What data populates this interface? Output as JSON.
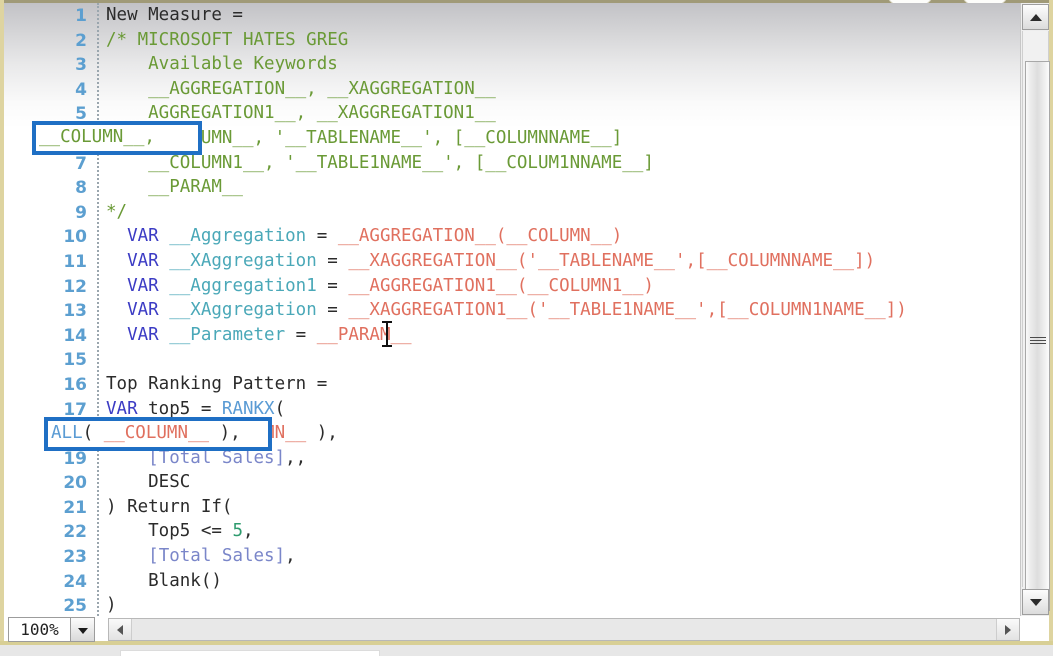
{
  "window": {
    "kind": "dax-formula-editor",
    "accent_box_color": "#1f6fc4",
    "frame_color": "#ded4a0",
    "linenumber_color": "#5c9fd0"
  },
  "gutter": {
    "line_numbers": [
      "1",
      "2",
      "3",
      "4",
      "5",
      "6",
      "7",
      "8",
      "9",
      "10",
      "11",
      "12",
      "13",
      "14",
      "15",
      "16",
      "17",
      "18",
      "19",
      "20",
      "21",
      "22",
      "23",
      "24",
      "25"
    ]
  },
  "code": {
    "lines": [
      {
        "n": "1",
        "tokens": [
          {
            "t": "New Measure =",
            "c": "tok-plain"
          }
        ]
      },
      {
        "n": "2",
        "tokens": [
          {
            "t": "/* MICROSOFT HATES GREG",
            "c": "tok-comment"
          }
        ]
      },
      {
        "n": "3",
        "tokens": [
          {
            "t": "    Available Keywords",
            "c": "tok-comment"
          }
        ]
      },
      {
        "n": "4",
        "tokens": [
          {
            "t": "    __AGGREGATION__, __XAGGREGATION__",
            "c": "tok-comment"
          }
        ]
      },
      {
        "n": "5",
        "tokens": [
          {
            "t": "    AGGREGATION1__, __XAGGREGATION1__",
            "c": "tok-comment"
          }
        ]
      },
      {
        "n": "6",
        "tokens": [
          {
            "t": "    __COLUMN__, '__TABLENAME__', [__COLUMNNAME__]",
            "c": "tok-comment"
          }
        ]
      },
      {
        "n": "7",
        "tokens": [
          {
            "t": "    __COLUMN1__, '__TABLE1NAME__', [__COLUM1NNAME__]",
            "c": "tok-comment"
          }
        ]
      },
      {
        "n": "8",
        "tokens": [
          {
            "t": "    __PARAM__",
            "c": "tok-comment"
          }
        ]
      },
      {
        "n": "9",
        "tokens": [
          {
            "t": "*/",
            "c": "tok-comment"
          }
        ]
      },
      {
        "n": "10",
        "tokens": [
          {
            "t": "  ",
            "c": "tok-plain"
          },
          {
            "t": "VAR",
            "c": "tok-kw"
          },
          {
            "t": " ",
            "c": "tok-plain"
          },
          {
            "t": "__Aggregation",
            "c": "tok-var"
          },
          {
            "t": " = ",
            "c": "tok-plain"
          },
          {
            "t": "__AGGREGATION__(__COLUMN__)",
            "c": "tok-param"
          }
        ]
      },
      {
        "n": "11",
        "tokens": [
          {
            "t": "  ",
            "c": "tok-plain"
          },
          {
            "t": "VAR",
            "c": "tok-kw"
          },
          {
            "t": " ",
            "c": "tok-plain"
          },
          {
            "t": "__XAggregation",
            "c": "tok-var"
          },
          {
            "t": " = ",
            "c": "tok-plain"
          },
          {
            "t": "__XAGGREGATION__('__TABLENAME__',[__COLUMNNAME__])",
            "c": "tok-param"
          }
        ]
      },
      {
        "n": "12",
        "tokens": [
          {
            "t": "  ",
            "c": "tok-plain"
          },
          {
            "t": "VAR",
            "c": "tok-kw"
          },
          {
            "t": " ",
            "c": "tok-plain"
          },
          {
            "t": "__Aggregation1",
            "c": "tok-var"
          },
          {
            "t": " = ",
            "c": "tok-plain"
          },
          {
            "t": "__AGGREGATION1__(__COLUMN1__)",
            "c": "tok-param"
          }
        ]
      },
      {
        "n": "13",
        "tokens": [
          {
            "t": "  ",
            "c": "tok-plain"
          },
          {
            "t": "VAR",
            "c": "tok-kw"
          },
          {
            "t": " ",
            "c": "tok-plain"
          },
          {
            "t": "__XAggregation",
            "c": "tok-var"
          },
          {
            "t": " = ",
            "c": "tok-plain"
          },
          {
            "t": "__XAGGREGATION1__('__TABLE1NAME__',[__COLUMN1NAME__])",
            "c": "tok-param"
          }
        ]
      },
      {
        "n": "14",
        "tokens": [
          {
            "t": "  ",
            "c": "tok-plain"
          },
          {
            "t": "VAR",
            "c": "tok-kw"
          },
          {
            "t": " ",
            "c": "tok-plain"
          },
          {
            "t": "__Parameter",
            "c": "tok-var"
          },
          {
            "t": " = ",
            "c": "tok-plain"
          },
          {
            "t": "__PARAM__",
            "c": "tok-param"
          }
        ]
      },
      {
        "n": "15",
        "tokens": [
          {
            "t": "",
            "c": "tok-plain"
          }
        ]
      },
      {
        "n": "16",
        "tokens": [
          {
            "t": "Top Ranking Pattern =",
            "c": "tok-plain"
          }
        ]
      },
      {
        "n": "17",
        "tokens": [
          {
            "t": "VAR",
            "c": "tok-kw"
          },
          {
            "t": " top5 = ",
            "c": "tok-plain"
          },
          {
            "t": "RANKX",
            "c": "tok-func"
          },
          {
            "t": "(",
            "c": "tok-punc"
          }
        ]
      },
      {
        "n": "18",
        "tokens": [
          {
            "t": "    ",
            "c": "tok-plain"
          },
          {
            "t": "ALL",
            "c": "tok-func"
          },
          {
            "t": "( ",
            "c": "tok-punc"
          },
          {
            "t": "__COLUMN__",
            "c": "tok-param"
          },
          {
            "t": " ),",
            "c": "tok-punc"
          }
        ]
      },
      {
        "n": "19",
        "tokens": [
          {
            "t": "    ",
            "c": "tok-plain"
          },
          {
            "t": "[Total Sales]",
            "c": "tok-measure"
          },
          {
            "t": ",,",
            "c": "tok-punc"
          }
        ]
      },
      {
        "n": "20",
        "tokens": [
          {
            "t": "    DESC",
            "c": "tok-plain"
          }
        ]
      },
      {
        "n": "21",
        "tokens": [
          {
            "t": ") Return If(",
            "c": "tok-plain"
          }
        ]
      },
      {
        "n": "22",
        "tokens": [
          {
            "t": "    Top5 <= ",
            "c": "tok-plain"
          },
          {
            "t": "5",
            "c": "tok-num"
          },
          {
            "t": ",",
            "c": "tok-punc"
          }
        ]
      },
      {
        "n": "23",
        "tokens": [
          {
            "t": "    ",
            "c": "tok-plain"
          },
          {
            "t": "[Total Sales]",
            "c": "tok-measure"
          },
          {
            "t": ",",
            "c": "tok-punc"
          }
        ]
      },
      {
        "n": "24",
        "tokens": [
          {
            "t": "    Blank()",
            "c": "tok-plain"
          }
        ]
      },
      {
        "n": "25",
        "tokens": [
          {
            "t": ")",
            "c": "tok-plain"
          }
        ]
      }
    ]
  },
  "highlights": [
    {
      "label": "__COLUMN__,",
      "target_line": "6",
      "tokens": [
        {
          "t": "__COLUMN__,",
          "c": "tok-comment"
        }
      ]
    },
    {
      "label": "ALL( __COLUMN__ ),",
      "target_line": "18",
      "tokens": [
        {
          "t": "ALL",
          "c": "tok-func"
        },
        {
          "t": "( ",
          "c": "tok-punc"
        },
        {
          "t": "__COLUMN__",
          "c": "tok-param"
        },
        {
          "t": " ),",
          "c": "tok-punc"
        }
      ]
    }
  ],
  "statusbar": {
    "zoom_level": "100%",
    "zoom_dropdown_icon": "chevron-down-icon",
    "hscroll_left_icon": "arrow-left-icon",
    "hscroll_right_icon": "arrow-right-icon"
  },
  "vscrollbar": {
    "up_icon": "arrow-up-icon",
    "down_icon": "arrow-down-icon",
    "grip_icon": "grip-lines-icon"
  }
}
